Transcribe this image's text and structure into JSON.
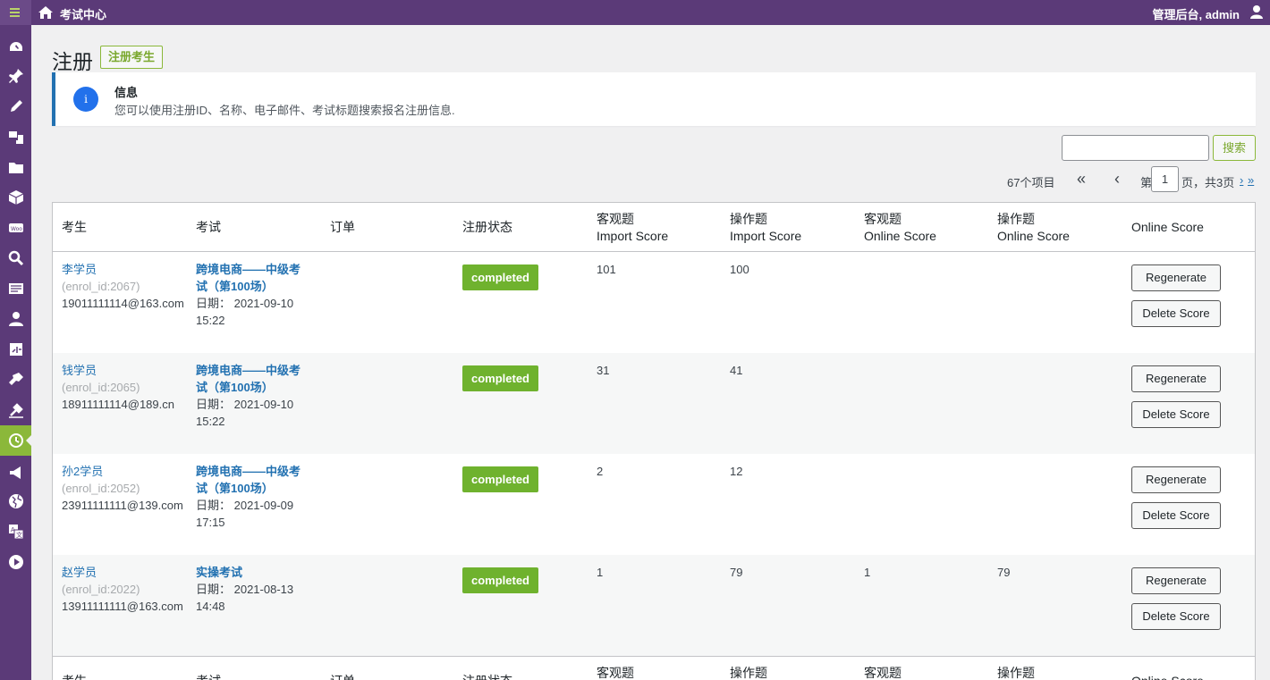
{
  "topbar": {
    "site_title": "考试中心",
    "account": "管理后台, admin"
  },
  "sidebar": {
    "icons": [
      "dashboard-icon",
      "pin-icon",
      "pencil-icon",
      "media-icon",
      "folder-icon",
      "box-icon",
      "woo-icon",
      "search-icon",
      "form-icon",
      "user-icon",
      "tools-icon",
      "plugin-icon",
      "settings-icon",
      "exam-icon",
      "megaphone-icon",
      "globe-icon",
      "translate-icon",
      "play-icon"
    ],
    "active_index": 13
  },
  "page": {
    "title": "注册",
    "add_button": "注册考生"
  },
  "notice": {
    "title": "信息",
    "text": "您可以使用注册ID、名称、电子邮件、考试标题搜索报名注册信息."
  },
  "search": {
    "button": "搜索",
    "value": ""
  },
  "pager": {
    "count": "67个项目",
    "first": "«",
    "prev": "‹",
    "label_before": "第",
    "current": "1",
    "label_after": "页，共3页",
    "next": "›",
    "last": "»"
  },
  "table": {
    "headers": [
      "考生",
      "考试",
      "订单",
      "注册状态",
      "客观题\nImport Score",
      "操作题\nImport Score",
      "客观题\nOnline Score",
      "操作题\nOnline Score",
      "Online Score"
    ],
    "rows": [
      {
        "name": "李学员",
        "enrol": "(enrol_id:2067)",
        "email": "19011111114@163.com",
        "exam": "跨境电商——中级考试（第100场）",
        "date": "日期： 2021-09-10 15:22",
        "status": "completed",
        "obj_import": "101",
        "op_import": "100",
        "obj_online": "",
        "op_online": "",
        "regen": "Regenerate",
        "del": "Delete Score"
      },
      {
        "name": "钱学员",
        "enrol": "(enrol_id:2065)",
        "email": "18911111114@189.cn",
        "exam": "跨境电商——中级考试（第100场）",
        "date": "日期： 2021-09-10 15:22",
        "status": "completed",
        "obj_import": "31",
        "op_import": "41",
        "obj_online": "",
        "op_online": "",
        "regen": "Regenerate",
        "del": "Delete Score"
      },
      {
        "name": "孙2学员",
        "enrol": "(enrol_id:2052)",
        "email": "23911111111@139.com",
        "exam": "跨境电商——中级考试（第100场）",
        "date": "日期： 2021-09-09 17:15",
        "status": "completed",
        "obj_import": "2",
        "op_import": "12",
        "obj_online": "",
        "op_online": "",
        "regen": "Regenerate",
        "del": "Delete Score"
      },
      {
        "name": "赵学员",
        "enrol": "(enrol_id:2022)",
        "email": "13911111111@163.com",
        "exam": "实操考试",
        "date": "日期： 2021-08-13 14:48",
        "status": "completed",
        "obj_import": "1",
        "op_import": "79",
        "obj_online": "1",
        "op_online": "79",
        "regen": "Regenerate",
        "del": "Delete Score"
      }
    ]
  }
}
